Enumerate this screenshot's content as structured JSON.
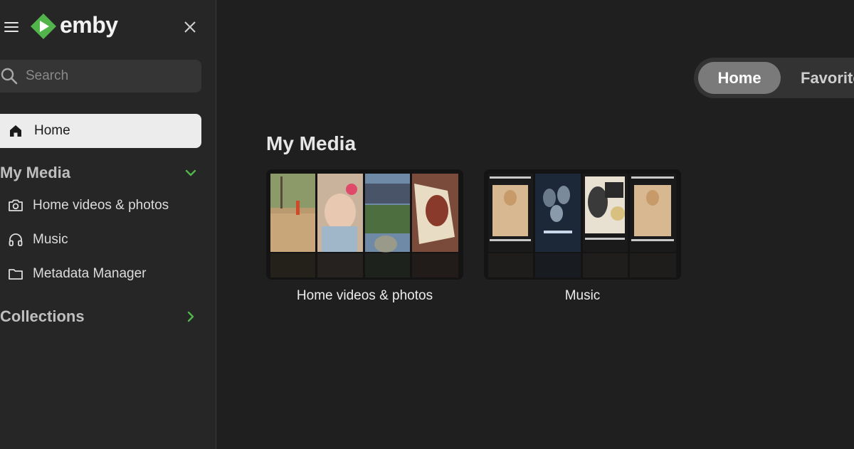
{
  "app": {
    "logo_text": "emby"
  },
  "search": {
    "placeholder": "Search"
  },
  "sidebar": {
    "home_label": "Home",
    "my_media": {
      "title": "My Media",
      "items": [
        {
          "label": "Home videos & photos",
          "icon": "camera-icon"
        },
        {
          "label": "Music",
          "icon": "headphones-icon"
        },
        {
          "label": "Metadata Manager",
          "icon": "folder-icon"
        }
      ]
    },
    "collections": {
      "title": "Collections"
    }
  },
  "tabs": [
    {
      "label": "Home",
      "active": true
    },
    {
      "label": "Favorites",
      "active": false
    }
  ],
  "main": {
    "section_title": "My Media",
    "libraries": [
      {
        "name": "Home videos & photos"
      },
      {
        "name": "Music"
      }
    ]
  },
  "colors": {
    "accent_green": "#52b54b",
    "background": "#1f1f1f",
    "sidebar": "#262626"
  }
}
